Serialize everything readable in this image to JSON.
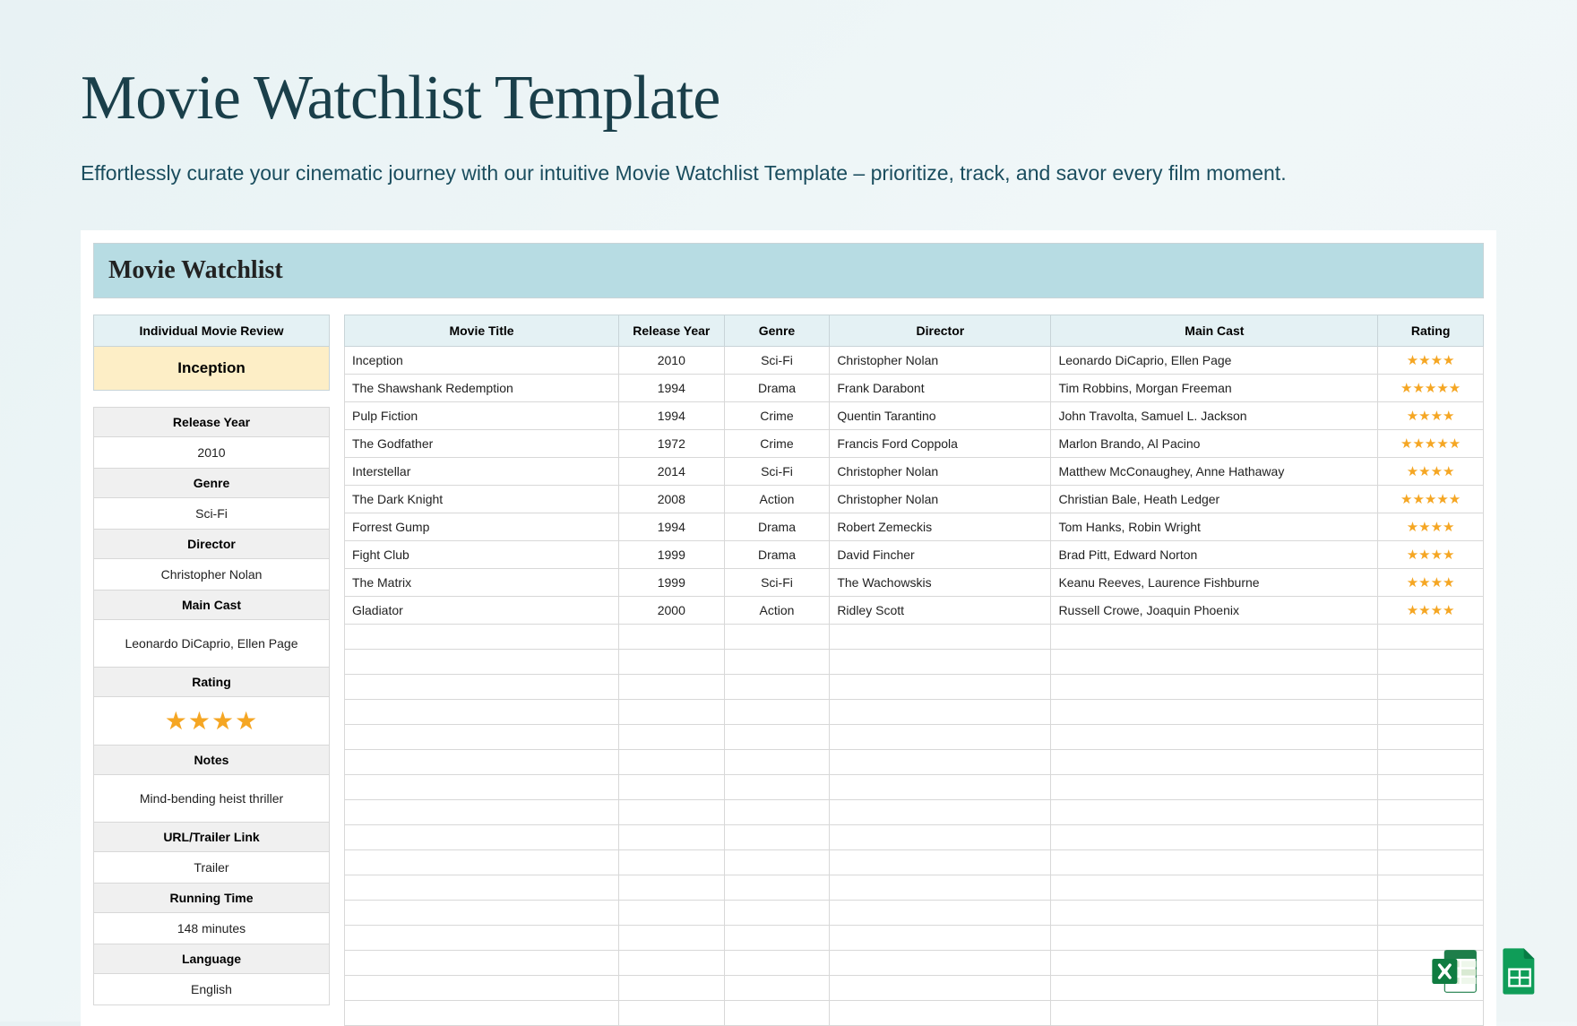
{
  "page": {
    "title": "Movie Watchlist Template",
    "subtitle": "Effortlessly curate your cinematic journey with our intuitive Movie Watchlist Template – prioritize, track, and savor every film moment."
  },
  "sheet": {
    "header": "Movie Watchlist",
    "side": {
      "header": "Individual Movie Review",
      "featured": "Inception",
      "fields": [
        {
          "label": "Release Year",
          "value": "2010"
        },
        {
          "label": "Genre",
          "value": "Sci-Fi"
        },
        {
          "label": "Director",
          "value": "Christopher Nolan"
        },
        {
          "label": "Main Cast",
          "value": "Leonardo DiCaprio, Ellen Page",
          "tall": true
        },
        {
          "label": "Rating",
          "value": "★★★★",
          "stars": true
        },
        {
          "label": "Notes",
          "value": "Mind-bending heist thriller",
          "tall": true
        },
        {
          "label": "URL/Trailer Link",
          "value": "Trailer"
        },
        {
          "label": "Running Time",
          "value": "148 minutes"
        },
        {
          "label": "Language",
          "value": "English"
        }
      ]
    },
    "columns": [
      "Movie Title",
      "Release Year",
      "Genre",
      "Director",
      "Main Cast",
      "Rating"
    ],
    "rows": [
      {
        "title": "Inception",
        "year": "2010",
        "genre": "Sci-Fi",
        "director": "Christopher Nolan",
        "cast": "Leonardo DiCaprio, Ellen Page",
        "rating": 4
      },
      {
        "title": "The Shawshank Redemption",
        "year": "1994",
        "genre": "Drama",
        "director": "Frank Darabont",
        "cast": "Tim Robbins, Morgan Freeman",
        "rating": 5
      },
      {
        "title": "Pulp Fiction",
        "year": "1994",
        "genre": "Crime",
        "director": "Quentin Tarantino",
        "cast": "John Travolta, Samuel L. Jackson",
        "rating": 4
      },
      {
        "title": "The Godfather",
        "year": "1972",
        "genre": "Crime",
        "director": "Francis Ford Coppola",
        "cast": "Marlon Brando, Al Pacino",
        "rating": 5
      },
      {
        "title": "Interstellar",
        "year": "2014",
        "genre": "Sci-Fi",
        "director": "Christopher Nolan",
        "cast": "Matthew McConaughey, Anne Hathaway",
        "rating": 4
      },
      {
        "title": "The Dark Knight",
        "year": "2008",
        "genre": "Action",
        "director": "Christopher Nolan",
        "cast": "Christian Bale, Heath Ledger",
        "rating": 5
      },
      {
        "title": "Forrest Gump",
        "year": "1994",
        "genre": "Drama",
        "director": "Robert Zemeckis",
        "cast": "Tom Hanks, Robin Wright",
        "rating": 4
      },
      {
        "title": "Fight Club",
        "year": "1999",
        "genre": "Drama",
        "director": "David Fincher",
        "cast": "Brad Pitt, Edward Norton",
        "rating": 4
      },
      {
        "title": "The Matrix",
        "year": "1999",
        "genre": "Sci-Fi",
        "director": "The Wachowskis",
        "cast": "Keanu Reeves, Laurence Fishburne",
        "rating": 4
      },
      {
        "title": "Gladiator",
        "year": "2000",
        "genre": "Action",
        "director": "Ridley Scott",
        "cast": "Russell Crowe, Joaquin Phoenix",
        "rating": 4
      }
    ],
    "emptyRows": 16
  },
  "icons": {
    "excel": "excel-icon",
    "sheets": "sheets-icon"
  }
}
